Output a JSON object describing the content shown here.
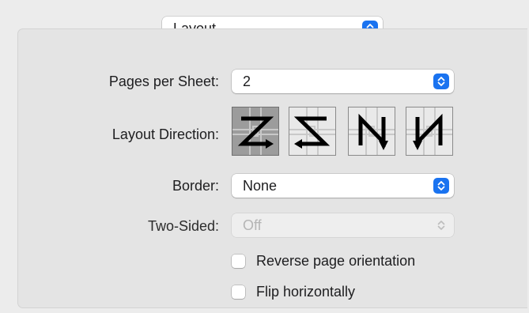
{
  "section_popup": {
    "value": "Layout"
  },
  "pages_per_sheet": {
    "label": "Pages per Sheet:",
    "value": "2"
  },
  "layout_direction": {
    "label": "Layout Direction:",
    "options": [
      {
        "glyph": "Z",
        "name": "left-right-top-bottom",
        "selected": true
      },
      {
        "glyph": "Z",
        "name": "right-left-top-bottom",
        "selected": false
      },
      {
        "glyph": "N",
        "name": "top-bottom-right-left",
        "selected": false
      },
      {
        "glyph": "N",
        "name": "top-bottom-left-right",
        "selected": false
      }
    ]
  },
  "border": {
    "label": "Border:",
    "value": "None"
  },
  "two_sided": {
    "label": "Two-Sided:",
    "value": "Off",
    "enabled": false
  },
  "reverse_orientation": {
    "label": "Reverse page orientation",
    "checked": false
  },
  "flip_horizontally": {
    "label": "Flip horizontally",
    "checked": false
  },
  "colors": {
    "accent": "#1a73f0",
    "panel_bg": "#e4e4e4",
    "window_bg": "#ececec"
  }
}
